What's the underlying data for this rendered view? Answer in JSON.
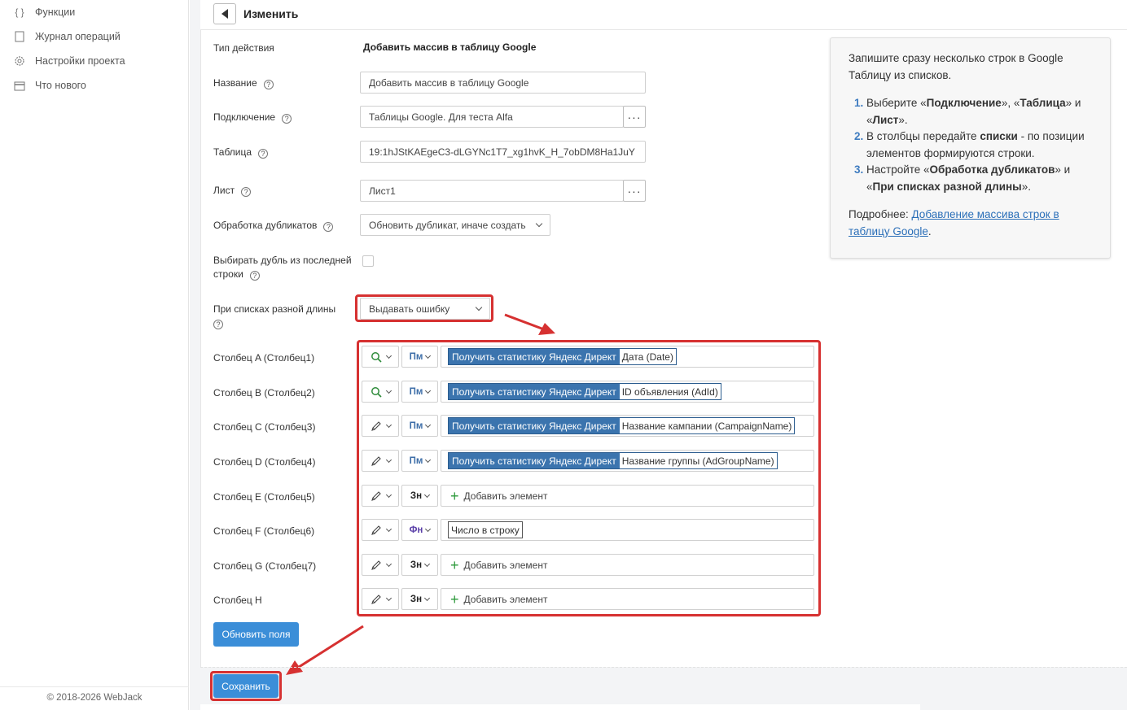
{
  "sidebar": {
    "items": [
      {
        "label": "Функции",
        "icon": "braces-icon"
      },
      {
        "label": "Журнал операций",
        "icon": "journal-icon"
      },
      {
        "label": "Настройки проекта",
        "icon": "gear-icon"
      },
      {
        "label": "Что нового",
        "icon": "calendar-icon"
      }
    ],
    "footer": "© 2018-2026 WebJack"
  },
  "header": {
    "title": "Изменить"
  },
  "form": {
    "action_type_label": "Тип действия",
    "action_type_value": "Добавить массив в таблицу Google",
    "name_label": "Название",
    "name_value": "Добавить массив в таблицу Google",
    "connection_label": "Подключение",
    "connection_value": "Таблицы Google. Для теста Alfa",
    "table_label": "Таблица",
    "table_value": "19:1hJStKAEgeC3-dLGYNc1T7_xg1hvK_H_7obDM8Ha1JuY",
    "sheet_label": "Лист",
    "sheet_value": "Лист1",
    "dup_label": "Обработка дубликатов",
    "dup_value": "Обновить дубликат, иначе создать",
    "last_row_label_1": "Выбирать дубль из последней",
    "last_row_label_2": "строки",
    "diff_len_label": "При списках разной длины",
    "diff_len_value": "Выдавать ошибку",
    "dots": "···"
  },
  "columns": [
    {
      "label": "Столбец A (Столбец1)",
      "mode_icon": "search-icon",
      "type": "Пм",
      "kind": "tag",
      "source": "Получить статистику Яндекс Директ",
      "field": "Дата (Date)"
    },
    {
      "label": "Столбец B (Столбец2)",
      "mode_icon": "search-icon",
      "type": "Пм",
      "kind": "tag",
      "source": "Получить статистику Яндекс Директ",
      "field": "ID объявления (AdId)"
    },
    {
      "label": "Столбец C (Столбец3)",
      "mode_icon": "pencil-icon",
      "type": "Пм",
      "kind": "tag",
      "source": "Получить статистику Яндекс Директ",
      "field": "Название кампании (CampaignName)"
    },
    {
      "label": "Столбец D (Столбец4)",
      "mode_icon": "pencil-icon",
      "type": "Пм",
      "kind": "tag",
      "source": "Получить статистику Яндекс Директ",
      "field": "Название группы (AdGroupName)"
    },
    {
      "label": "Столбец E (Столбец5)",
      "mode_icon": "pencil-icon",
      "type": "Зн",
      "kind": "add",
      "add_label": "Добавить элемент"
    },
    {
      "label": "Столбец F (Столбец6)",
      "mode_icon": "pencil-icon",
      "type": "Фн",
      "kind": "single",
      "value": "Число в строку"
    },
    {
      "label": "Столбец G (Столбец7)",
      "mode_icon": "pencil-icon",
      "type": "Зн",
      "kind": "add",
      "add_label": "Добавить элемент"
    },
    {
      "label": "Столбец H",
      "mode_icon": "pencil-icon",
      "type": "Зн",
      "kind": "add",
      "add_label": "Добавить элемент"
    }
  ],
  "buttons": {
    "update_fields": "Обновить поля",
    "save": "Сохранить"
  },
  "hint": {
    "intro": "Запишите сразу несколько строк в Google Таблицу из списков.",
    "step1_a": "Выберите «",
    "step1_b": "Подключение",
    "step1_c": "», «",
    "step1_d": "Таблица",
    "step1_e": "» и «",
    "step1_f": "Лист",
    "step1_g": "».",
    "step2_a": "В столбцы передайте ",
    "step2_b": "списки",
    "step2_c": " - по позиции элементов формируются строки.",
    "step3_a": "Настройте «",
    "step3_b": "Обработка дубликатов",
    "step3_c": "» и «",
    "step3_d": "При списках разной длины",
    "step3_e": "».",
    "more_label": "Подробнее: ",
    "more_link": "Добавление массива строк в таблицу Google",
    "more_end": "."
  },
  "colors": {
    "accent": "#3b8ed8",
    "highlight": "#d63131",
    "tag": "#3b74ae"
  }
}
